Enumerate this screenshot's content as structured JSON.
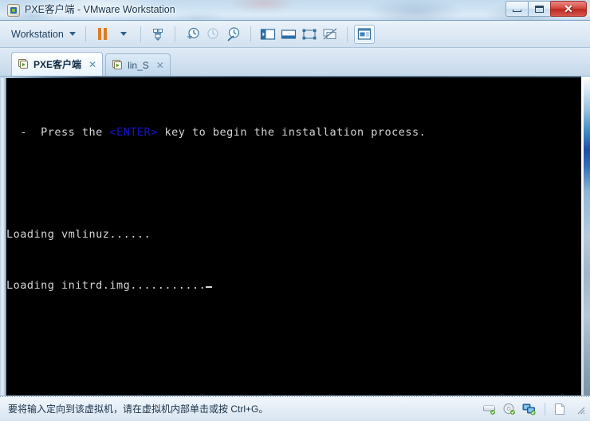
{
  "window": {
    "title": "PXE客户端 - VMware Workstation",
    "app_icon": "vmware-appicon",
    "controls": {
      "minimize_label": "",
      "maximize_label": "",
      "close_label": "✕"
    }
  },
  "toolbar": {
    "menu_label": "Workstation",
    "items": [
      {
        "name": "pause-vm-button",
        "icon": "pause-icon",
        "label": ""
      },
      {
        "name": "power-dropdown-button",
        "icon": "chevron-down-icon",
        "label": ""
      },
      {
        "name": "manage-vm-settings-button",
        "icon": "vm-settings-icon",
        "label": ""
      },
      {
        "name": "take-snapshot-button",
        "icon": "snapshot-add-icon",
        "label": ""
      },
      {
        "name": "revert-snapshot-button",
        "icon": "snapshot-revert-icon",
        "label": ""
      },
      {
        "name": "snapshot-manager-button",
        "icon": "snapshot-manager-icon",
        "label": ""
      },
      {
        "name": "show-library-button",
        "icon": "library-panel-icon",
        "label": ""
      },
      {
        "name": "show-thumbnail-bar-button",
        "icon": "thumbnail-bar-icon",
        "label": ""
      },
      {
        "name": "enter-fullscreen-button",
        "icon": "fullscreen-icon",
        "label": ""
      },
      {
        "name": "unity-mode-button",
        "icon": "unity-mode-icon",
        "label": ""
      },
      {
        "name": "console-view-button",
        "icon": "console-view-icon",
        "label": ""
      }
    ]
  },
  "tabs": [
    {
      "label": "PXE客户端",
      "close_label": "✕",
      "active": true,
      "icon": "vm-tab-icon"
    },
    {
      "label": "lin_S",
      "close_label": "✕",
      "active": false,
      "icon": "vm-tab-icon"
    }
  ],
  "terminal": {
    "lines": [
      {
        "id": "l1",
        "text": "  -  Press the "
      },
      {
        "id": "l1kw",
        "text": "<ENTER>"
      },
      {
        "id": "l1b",
        "text": " key to begin the installation process."
      },
      {
        "id": "l2",
        "text": ""
      },
      {
        "id": "l3",
        "text": "Loading vmlinuz......"
      },
      {
        "id": "l4",
        "text": "Loading initrd.img..........."
      }
    ],
    "prompt_line_1_prefix": "  -  Press the ",
    "prompt_line_1_keyword": "<ENTER>",
    "prompt_line_1_suffix": " key to begin the installation process.",
    "loading_vmlinuz": "Loading vmlinuz......",
    "loading_initrd": "Loading initrd.img...........",
    "cursor": "_",
    "background_color": "#000000",
    "text_color": "#d6d6d6",
    "keyword_color": "#1414cf"
  },
  "statusbar": {
    "message": "要将输入定向到该虚拟机，请在虚拟机内部单击或按 Ctrl+G。",
    "devices": [
      {
        "name": "status-harddisk-icon",
        "label": "hard-disk"
      },
      {
        "name": "status-cddvd-icon",
        "label": "cd-dvd"
      },
      {
        "name": "status-network-icon",
        "label": "network-adapter"
      },
      {
        "name": "status-document-icon",
        "label": "blank-document"
      }
    ]
  }
}
